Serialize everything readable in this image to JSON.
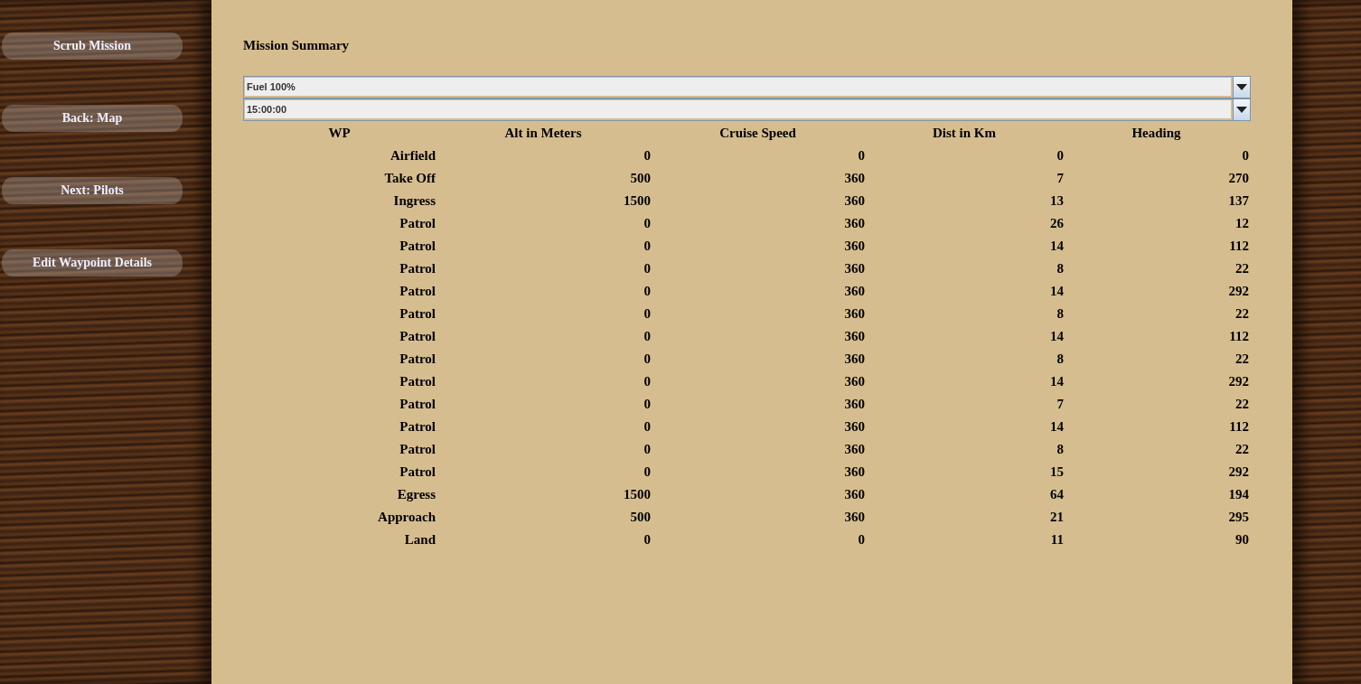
{
  "sidebar": {
    "buttons": [
      "Scrub Mission",
      "Back: Map",
      "Next: Pilots",
      "Edit Waypoint Details"
    ]
  },
  "title": "Mission Summary",
  "dropdowns": [
    {
      "value": "Fuel 100%"
    },
    {
      "value": "15:00:00"
    }
  ],
  "table": {
    "columns": [
      "WP",
      "Alt in Meters",
      "Cruise Speed",
      "Dist in Km",
      "Heading"
    ],
    "rows": [
      [
        "Airfield",
        "0",
        "0",
        "0",
        "0"
      ],
      [
        "Take Off",
        "500",
        "360",
        "7",
        "270"
      ],
      [
        "Ingress",
        "1500",
        "360",
        "13",
        "137"
      ],
      [
        "Patrol",
        "0",
        "360",
        "26",
        "12"
      ],
      [
        "Patrol",
        "0",
        "360",
        "14",
        "112"
      ],
      [
        "Patrol",
        "0",
        "360",
        "8",
        "22"
      ],
      [
        "Patrol",
        "0",
        "360",
        "14",
        "292"
      ],
      [
        "Patrol",
        "0",
        "360",
        "8",
        "22"
      ],
      [
        "Patrol",
        "0",
        "360",
        "14",
        "112"
      ],
      [
        "Patrol",
        "0",
        "360",
        "8",
        "22"
      ],
      [
        "Patrol",
        "0",
        "360",
        "14",
        "292"
      ],
      [
        "Patrol",
        "0",
        "360",
        "7",
        "22"
      ],
      [
        "Patrol",
        "0",
        "360",
        "14",
        "112"
      ],
      [
        "Patrol",
        "0",
        "360",
        "8",
        "22"
      ],
      [
        "Patrol",
        "0",
        "360",
        "15",
        "292"
      ],
      [
        "Egress",
        "1500",
        "360",
        "64",
        "194"
      ],
      [
        "Approach",
        "500",
        "360",
        "21",
        "295"
      ],
      [
        "Land",
        "0",
        "0",
        "11",
        "90"
      ]
    ]
  }
}
